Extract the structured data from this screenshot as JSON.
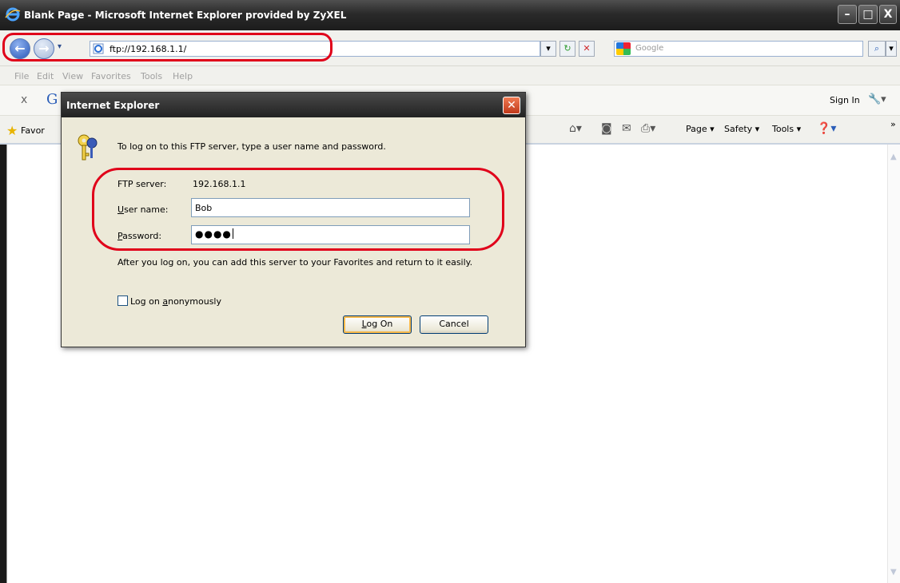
{
  "window": {
    "title": "Blank Page - Microsoft Internet Explorer provided by ZyXEL",
    "minimize": "–",
    "maximize": "□",
    "close": "X"
  },
  "navbar": {
    "back_icon": "←",
    "forward_icon": "→",
    "dropdown_icon": "▾",
    "address": "ftp://192.168.1.1/",
    "search_placeholder": "Google",
    "search_icon": "⌕"
  },
  "menubar": [
    "File",
    "Edit",
    "View",
    "Favorites",
    "Tools",
    "Help"
  ],
  "google_toolbar": {
    "close": "x",
    "logo": "G",
    "sign_in": "Sign In"
  },
  "favorites_bar": {
    "favorites": "Favor",
    "page": "Page ▾",
    "safety": "Safety ▾",
    "tools": "Tools ▾"
  },
  "dialog": {
    "title": "Internet Explorer",
    "close": "✕",
    "prompt": "To log on to this FTP server, type a user name and password.",
    "ftp_server_label": "FTP server:",
    "ftp_server_value": "192.168.1.1",
    "user_name_label_u": "U",
    "user_name_label_rest": "ser name:",
    "user_name_value": "Bob",
    "password_label_u": "P",
    "password_label_rest": "assword:",
    "password_value": "●●●●",
    "note": "After you log on, you can add this server to your Favorites and return to it easily.",
    "anon_label_pre": "Log on ",
    "anon_label_u": "a",
    "anon_label_post": "nonymously",
    "anon_checked": false,
    "logon_pre": "",
    "logon_u": "L",
    "logon_post": "og On",
    "cancel": "Cancel"
  },
  "colors": {
    "highlight": "#e0001a",
    "titlebar": "#2a2a2a",
    "dialog_bg": "#ece9d8"
  }
}
